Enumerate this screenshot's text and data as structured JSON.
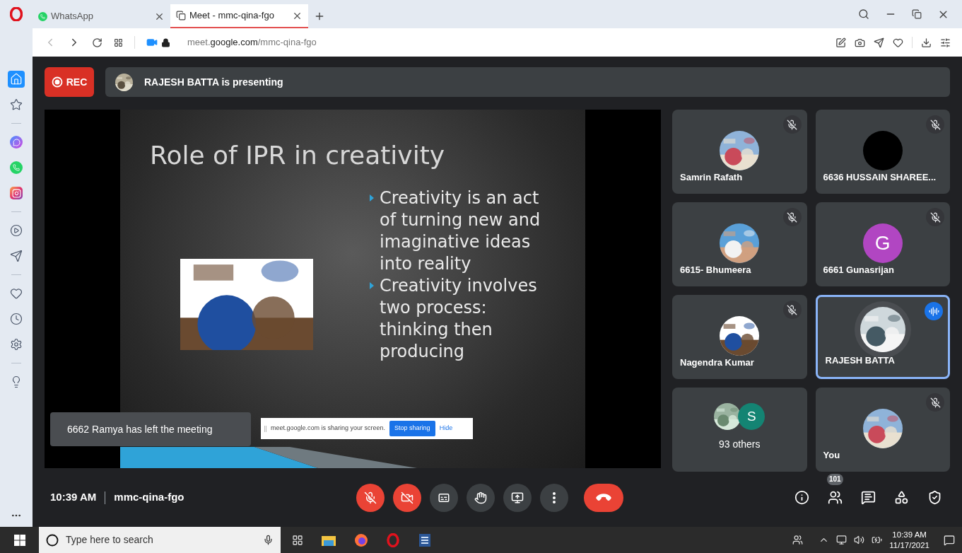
{
  "browser": {
    "tabs": [
      {
        "title": "WhatsApp",
        "kind": "whatsapp",
        "selected": false
      },
      {
        "title": "Meet - mmc-qina-fgo",
        "kind": "meet",
        "selected": true
      }
    ],
    "address": {
      "subdomain": "meet.",
      "domain": "google.com",
      "path": "/mmc-qina-fgo"
    }
  },
  "sidebar": [
    {
      "items": [
        {
          "kind": "home",
          "selected": true
        },
        {
          "kind": "star",
          "selected": false
        }
      ]
    },
    {
      "items": [
        {
          "kind": "messenger",
          "selected": false
        },
        {
          "kind": "whatsapp",
          "selected": false
        },
        {
          "kind": "instagram",
          "selected": false
        }
      ]
    },
    {
      "items": [
        {
          "kind": "player",
          "selected": false
        },
        {
          "kind": "send",
          "selected": false
        }
      ]
    },
    {
      "items": [
        {
          "kind": "heart",
          "selected": false
        },
        {
          "kind": "clock",
          "selected": false
        },
        {
          "kind": "settings",
          "selected": false
        }
      ]
    },
    {
      "items": [
        {
          "kind": "tips",
          "selected": false
        }
      ]
    }
  ],
  "meet": {
    "rec": "REC",
    "presenting": "RAJESH BATTA is presenting",
    "slide": {
      "title": "Role of IPR in creativity",
      "bullets": [
        "Creativity is an act of turning new and imaginative ideas into reality",
        "Creativity involves two process: thinking then producing"
      ]
    },
    "toast": "6662 Ramya has left the meeting",
    "share_bar": {
      "message": "meet.google.com is sharing your screen.",
      "stop": "Stop sharing",
      "hide": "Hide"
    },
    "tiles": [
      {
        "name": "Samrin Rafath",
        "kind": "picture",
        "muted": true,
        "speaking": false
      },
      {
        "name": "6636 HUSSAIN SHAREE...",
        "kind": "blank",
        "muted": true,
        "speaking": false
      },
      {
        "name": "6615- Bhumeera",
        "kind": "picture",
        "muted": true,
        "speaking": false
      },
      {
        "name": "6661 Gunasrijan",
        "kind": "initial",
        "initial": "G",
        "color": "#b146c2",
        "muted": true,
        "speaking": false
      },
      {
        "name": "Nagendra Kumar",
        "kind": "picture",
        "muted": true,
        "speaking": false
      },
      {
        "name": "RAJESH BATTA",
        "kind": "picture",
        "muted": false,
        "speaking": true
      },
      {
        "name": "93 others",
        "kind": "others",
        "initial": "S",
        "color": "#148473",
        "muted": false,
        "speaking": false
      },
      {
        "name": "You",
        "kind": "picture",
        "muted": true,
        "speaking": false
      }
    ],
    "time": "10:39 AM",
    "code": "mmc-qina-fgo",
    "controls": [
      {
        "kind": "mic",
        "on": false
      },
      {
        "kind": "camera",
        "on": false
      },
      {
        "kind": "captions",
        "on": false
      },
      {
        "kind": "hand",
        "on": false
      },
      {
        "kind": "present",
        "on": false
      },
      {
        "kind": "more",
        "on": false
      },
      {
        "kind": "end",
        "on": false
      }
    ],
    "side_controls": [
      {
        "kind": "info"
      },
      {
        "kind": "people",
        "badge": "101"
      },
      {
        "kind": "chat"
      },
      {
        "kind": "activities"
      },
      {
        "kind": "host"
      }
    ]
  },
  "taskbar": {
    "search_placeholder": "Type here to search",
    "time": "10:39 AM",
    "date": "11/17/2021"
  }
}
